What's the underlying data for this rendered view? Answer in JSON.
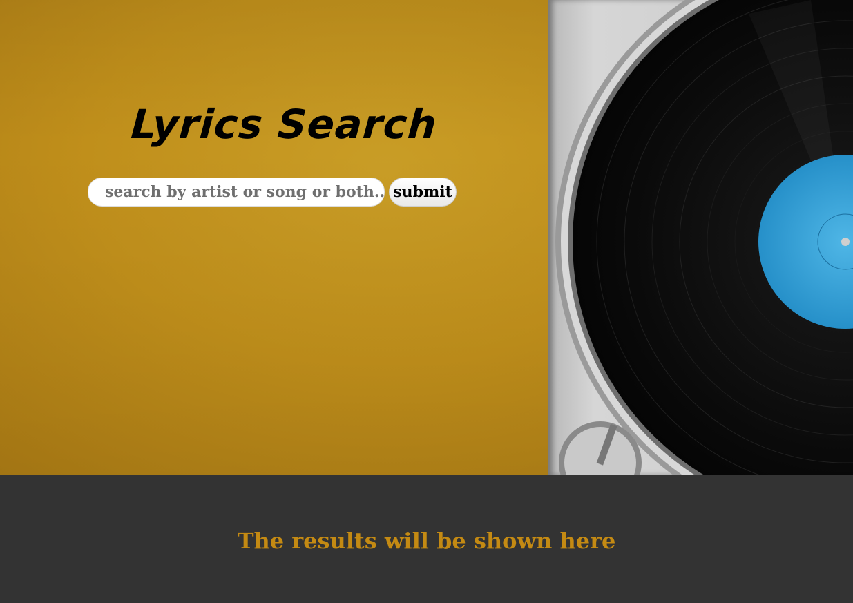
{
  "header": {
    "title": "Lyrics Search"
  },
  "search": {
    "placeholder": "search by artist or song or both...",
    "value": "",
    "submit_label": "submit"
  },
  "results": {
    "message": "The results will be shown here"
  },
  "colors": {
    "hero_background": "#c0901c",
    "results_background": "#333333",
    "results_text": "#c48a13",
    "record_label": "#2a9fd8"
  },
  "background_image": {
    "subject": "vinyl-record-turntable"
  }
}
